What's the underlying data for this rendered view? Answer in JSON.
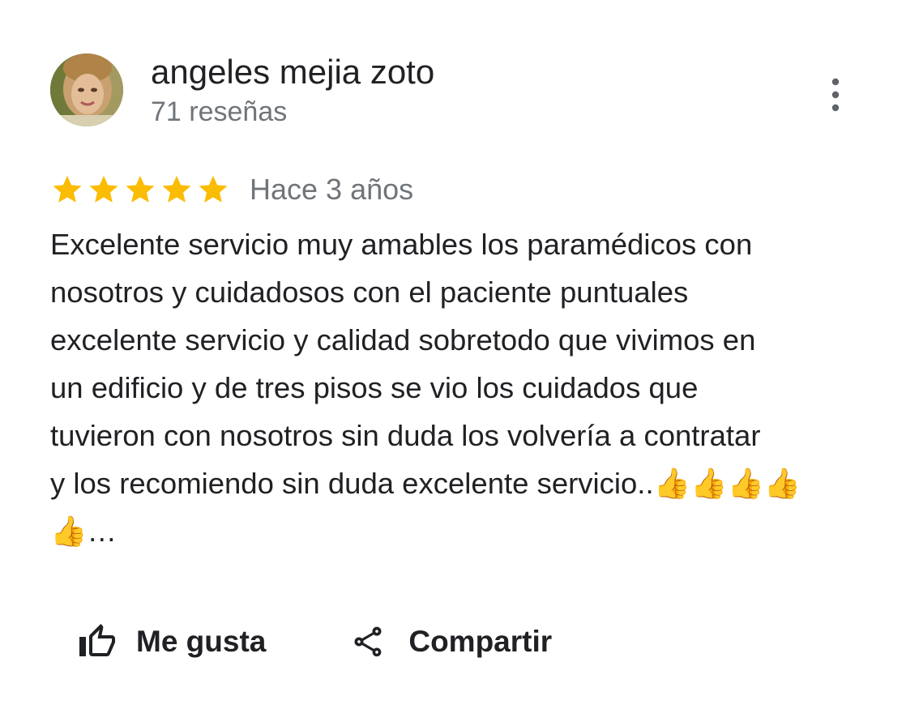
{
  "review": {
    "author": {
      "name": "angeles mejia zoto",
      "reviews_count": "71 reseñas",
      "avatar": "profile-photo"
    },
    "rating": {
      "stars": 5,
      "max": 5,
      "color": "#fbbc04"
    },
    "time_ago": "Hace 3 años",
    "text": "Excelente servicio muy amables los paramédicos con\nnosotros y cuidadosos con el paciente puntuales\nexcelente servicio y calidad sobretodo que vivimos en\nun edificio y de tres pisos se vio los cuidados que\ntuvieron con nosotros sin duda los volvería a contratar\ny los recomiendo sin duda excelente servicio..👍👍👍👍\n👍…",
    "more_menu_icon": "more-vert-icon"
  },
  "actions": {
    "like": {
      "icon": "thumb-up-outline-icon",
      "label": "Me gusta"
    },
    "share": {
      "icon": "share-icon",
      "label": "Compartir"
    }
  }
}
